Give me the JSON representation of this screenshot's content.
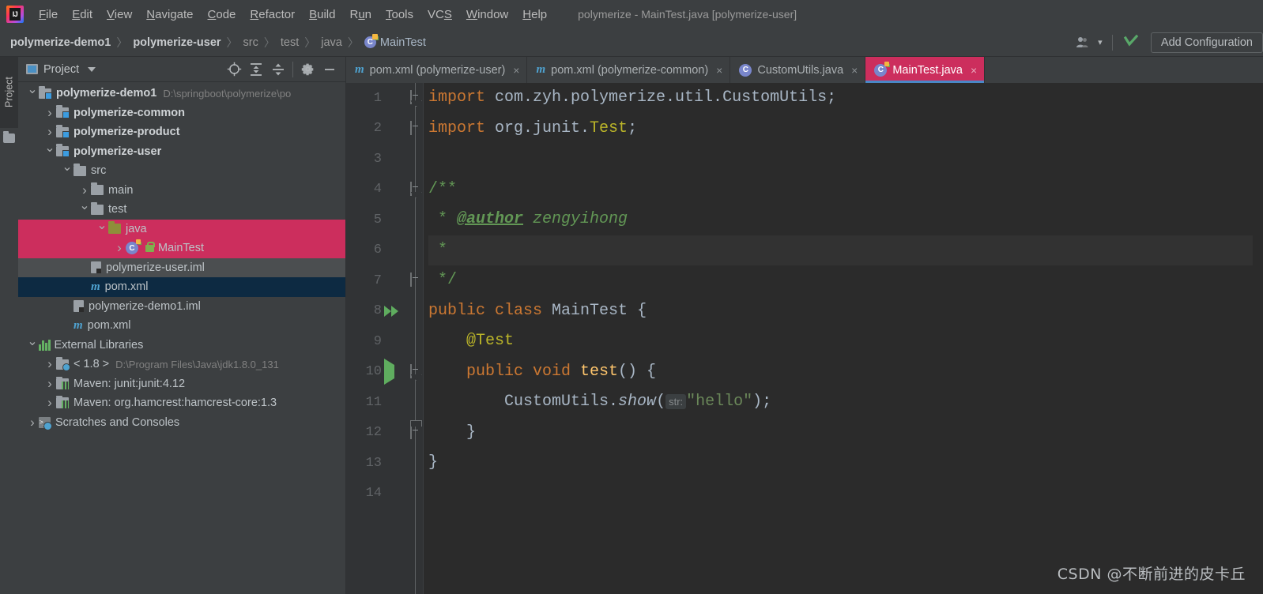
{
  "window": {
    "title": "polymerize - MainTest.java [polymerize-user]"
  },
  "menubar": {
    "logo_text": "IJ",
    "items": [
      {
        "label": "File",
        "mnemonic": "F"
      },
      {
        "label": "Edit",
        "mnemonic": "E"
      },
      {
        "label": "View",
        "mnemonic": "V"
      },
      {
        "label": "Navigate",
        "mnemonic": "N"
      },
      {
        "label": "Code",
        "mnemonic": "C"
      },
      {
        "label": "Refactor",
        "mnemonic": "R"
      },
      {
        "label": "Build",
        "mnemonic": "B"
      },
      {
        "label": "Run",
        "mnemonic": "u"
      },
      {
        "label": "Tools",
        "mnemonic": "T"
      },
      {
        "label": "VCS",
        "mnemonic": "S"
      },
      {
        "label": "Window",
        "mnemonic": "W"
      },
      {
        "label": "Help",
        "mnemonic": "H"
      }
    ]
  },
  "breadcrumb": {
    "separator": "〉",
    "items": [
      {
        "label": "polymerize-demo1",
        "style": "bold"
      },
      {
        "label": "polymerize-user",
        "style": "bold"
      },
      {
        "label": "src",
        "style": "dim"
      },
      {
        "label": "test",
        "style": "dim"
      },
      {
        "label": "java",
        "style": "dim"
      },
      {
        "label": "MainTest",
        "style": "file",
        "icon": "java-test-class-icon"
      }
    ]
  },
  "toolbar": {
    "user_icon": "user-avatar-icon",
    "user_caret": "▾",
    "search_everywhere_icon": "checkmark-green-icon",
    "add_configuration_label": "Add Configuration"
  },
  "left_strip": {
    "project_tab_label": "Project",
    "folder_icon": "folder-icon"
  },
  "project_panel": {
    "header": {
      "title": "Project",
      "dropdown_caret": "▾",
      "icons": [
        {
          "name": "locate-target-icon",
          "glyph": "⊕"
        },
        {
          "name": "expand-all-icon",
          "glyph": "↨"
        },
        {
          "name": "collapse-all-icon",
          "glyph": "↧"
        },
        {
          "name": "settings-gear-icon",
          "glyph": "⚙"
        },
        {
          "name": "hide-panel-icon",
          "glyph": "−"
        }
      ]
    },
    "tree": [
      {
        "id": "polymerize-demo1",
        "label": "polymerize-demo1",
        "path": "D:\\springboot\\polymerize\\po",
        "indent": 0,
        "arrow": "open",
        "icon": "module-icon",
        "bold": true,
        "selected": "none"
      },
      {
        "id": "polymerize-common",
        "label": "polymerize-common",
        "path": "",
        "indent": 1,
        "arrow": "closed",
        "icon": "module-icon",
        "bold": true,
        "selected": "none"
      },
      {
        "id": "polymerize-product",
        "label": "polymerize-product",
        "path": "",
        "indent": 1,
        "arrow": "closed",
        "icon": "module-icon",
        "bold": true,
        "selected": "none"
      },
      {
        "id": "polymerize-user",
        "label": "polymerize-user",
        "path": "",
        "indent": 1,
        "arrow": "open",
        "icon": "module-icon",
        "bold": true,
        "selected": "none"
      },
      {
        "id": "src",
        "label": "src",
        "path": "",
        "indent": 2,
        "arrow": "open",
        "icon": "folder-icon",
        "bold": false,
        "selected": "none"
      },
      {
        "id": "main",
        "label": "main",
        "path": "",
        "indent": 3,
        "arrow": "closed",
        "icon": "folder-icon",
        "bold": false,
        "selected": "none"
      },
      {
        "id": "test",
        "label": "test",
        "path": "",
        "indent": 3,
        "arrow": "open",
        "icon": "folder-icon",
        "bold": false,
        "selected": "none"
      },
      {
        "id": "java",
        "label": "java",
        "path": "",
        "indent": 4,
        "arrow": "open",
        "icon": "source-folder-icon",
        "bold": false,
        "selected": "pink"
      },
      {
        "id": "MainTest",
        "label": "MainTest",
        "path": "",
        "indent": 5,
        "arrow": "closed",
        "icon": "java-test-class-icon",
        "bold": false,
        "selected": "pink"
      },
      {
        "id": "polymerize-user.iml",
        "label": "polymerize-user.iml",
        "path": "",
        "indent": 3,
        "arrow": "none",
        "icon": "iml-file-icon",
        "bold": false,
        "selected": "grey"
      },
      {
        "id": "pom.xml-user",
        "label": "pom.xml",
        "path": "",
        "indent": 3,
        "arrow": "none",
        "icon": "maven-file-icon",
        "bold": false,
        "selected": "blue"
      },
      {
        "id": "polymerize-demo1.iml",
        "label": "polymerize-demo1.iml",
        "path": "",
        "indent": 2,
        "arrow": "none",
        "icon": "iml-file-icon",
        "bold": false,
        "selected": "none"
      },
      {
        "id": "pom.xml-root",
        "label": "pom.xml",
        "path": "",
        "indent": 2,
        "arrow": "none",
        "icon": "maven-file-icon",
        "bold": false,
        "selected": "none"
      },
      {
        "id": "External Libraries",
        "label": "External Libraries",
        "path": "",
        "indent": 0,
        "arrow": "open",
        "icon": "external-libraries-icon",
        "bold": false,
        "selected": "none"
      },
      {
        "id": "jdk",
        "label": "< 1.8 >",
        "path": "D:\\Program Files\\Java\\jdk1.8.0_131",
        "indent": 1,
        "arrow": "closed",
        "icon": "jdk-folder-icon",
        "bold": false,
        "selected": "none"
      },
      {
        "id": "junit",
        "label": "Maven: junit:junit:4.12",
        "path": "",
        "indent": 1,
        "arrow": "closed",
        "icon": "library-icon",
        "bold": false,
        "selected": "none"
      },
      {
        "id": "hamcrest",
        "label": "Maven: org.hamcrest:hamcrest-core:1.3",
        "path": "",
        "indent": 1,
        "arrow": "closed",
        "icon": "library-icon",
        "bold": false,
        "selected": "none"
      },
      {
        "id": "Scratches",
        "label": "Scratches and Consoles",
        "path": "",
        "indent": 0,
        "arrow": "closed",
        "icon": "scratches-icon",
        "bold": false,
        "selected": "none"
      }
    ]
  },
  "editor": {
    "tabs": [
      {
        "label": "pom.xml (polymerize-user)",
        "icon": "maven-file-icon",
        "active": false,
        "close": "×"
      },
      {
        "label": "pom.xml (polymerize-common)",
        "icon": "maven-file-icon",
        "active": false,
        "close": "×"
      },
      {
        "label": "CustomUtils.java",
        "icon": "java-class-icon",
        "active": false,
        "close": "×"
      },
      {
        "label": "MainTest.java",
        "icon": "java-test-class-icon",
        "active": true,
        "close": "×"
      }
    ],
    "line_numbers": [
      "1",
      "2",
      "3",
      "4",
      "5",
      "6",
      "7",
      "8",
      "9",
      "10",
      "11",
      "12",
      "13",
      "14"
    ],
    "code_lines": [
      {
        "n": 1,
        "fold": "down",
        "run": "",
        "bulb": false,
        "highlight": false,
        "tokens": [
          {
            "t": "import ",
            "c": "kw"
          },
          {
            "t": "com.zyh.polymerize.util.",
            "c": "plain"
          },
          {
            "t": "CustomUtils",
            "c": "plain"
          },
          {
            "t": ";",
            "c": "plain"
          }
        ]
      },
      {
        "n": 2,
        "fold": "flat",
        "run": "",
        "bulb": false,
        "highlight": false,
        "tokens": [
          {
            "t": "import ",
            "c": "kw"
          },
          {
            "t": "org.junit.",
            "c": "plain"
          },
          {
            "t": "Test",
            "c": "ann"
          },
          {
            "t": ";",
            "c": "plain"
          }
        ]
      },
      {
        "n": 3,
        "fold": "",
        "run": "",
        "bulb": false,
        "highlight": false,
        "tokens": []
      },
      {
        "n": 4,
        "fold": "down",
        "run": "",
        "bulb": false,
        "highlight": false,
        "tokens": [
          {
            "t": "/**",
            "c": "cmt"
          }
        ]
      },
      {
        "n": 5,
        "fold": "",
        "run": "",
        "bulb": true,
        "highlight": false,
        "tokens": [
          {
            "t": " * ",
            "c": "cmt"
          },
          {
            "t": "@author",
            "c": "cmt-tag"
          },
          {
            "t": " zengyihong",
            "c": "cmt-val"
          }
        ]
      },
      {
        "n": 6,
        "fold": "",
        "run": "",
        "bulb": false,
        "highlight": true,
        "tokens": [
          {
            "t": " *",
            "c": "cmt"
          }
        ]
      },
      {
        "n": 7,
        "fold": "flat",
        "run": "",
        "bulb": false,
        "highlight": false,
        "tokens": [
          {
            "t": " */",
            "c": "cmt"
          }
        ]
      },
      {
        "n": 8,
        "fold": "",
        "run": "double",
        "bulb": false,
        "highlight": false,
        "tokens": [
          {
            "t": "public class ",
            "c": "kw"
          },
          {
            "t": "MainTest ",
            "c": "plain"
          },
          {
            "t": "{",
            "c": "plain"
          }
        ]
      },
      {
        "n": 9,
        "fold": "",
        "run": "",
        "bulb": false,
        "highlight": false,
        "tokens": [
          {
            "t": "    ",
            "c": "plain"
          },
          {
            "t": "@Test",
            "c": "ann"
          }
        ]
      },
      {
        "n": 10,
        "fold": "down",
        "run": "single",
        "bulb": false,
        "highlight": false,
        "tokens": [
          {
            "t": "    public void ",
            "c": "kw"
          },
          {
            "t": "test",
            "c": "methdef"
          },
          {
            "t": "() {",
            "c": "plain"
          }
        ]
      },
      {
        "n": 11,
        "fold": "",
        "run": "",
        "bulb": false,
        "highlight": false,
        "tokens": [
          {
            "t": "        CustomUtils.",
            "c": "plain"
          },
          {
            "t": "show",
            "c": "meth"
          },
          {
            "t": "(",
            "c": "plain"
          },
          {
            "t": "str:",
            "c": "hint"
          },
          {
            "t": "\"hello\"",
            "c": "str"
          },
          {
            "t": ");",
            "c": "plain"
          }
        ]
      },
      {
        "n": 12,
        "fold": "up",
        "run": "",
        "bulb": false,
        "highlight": false,
        "tokens": [
          {
            "t": "    }",
            "c": "plain"
          }
        ]
      },
      {
        "n": 13,
        "fold": "",
        "run": "",
        "bulb": false,
        "highlight": false,
        "tokens": [
          {
            "t": "}",
            "c": "plain"
          }
        ]
      },
      {
        "n": 14,
        "fold": "",
        "run": "",
        "bulb": false,
        "highlight": false,
        "tokens": []
      }
    ]
  },
  "watermark": {
    "text": "CSDN @不断前进的皮卡丘"
  },
  "colors": {
    "chrome_bg": "#3C3F41",
    "editor_bg": "#2B2B2B",
    "gutter_bg": "#313335",
    "selection_pink": "#CC2E5D",
    "selection_blue": "#0D2A42",
    "selection_grey": "#4B4E50",
    "accent_blue": "#4A88C7",
    "text_primary": "#A9B7C6",
    "keyword_orange": "#CC7832",
    "string_green": "#6A8759",
    "comment_green": "#629755",
    "annotation_yellow": "#BBB529",
    "method_yellow": "#FFC66D",
    "run_green": "#5FAD5F"
  }
}
